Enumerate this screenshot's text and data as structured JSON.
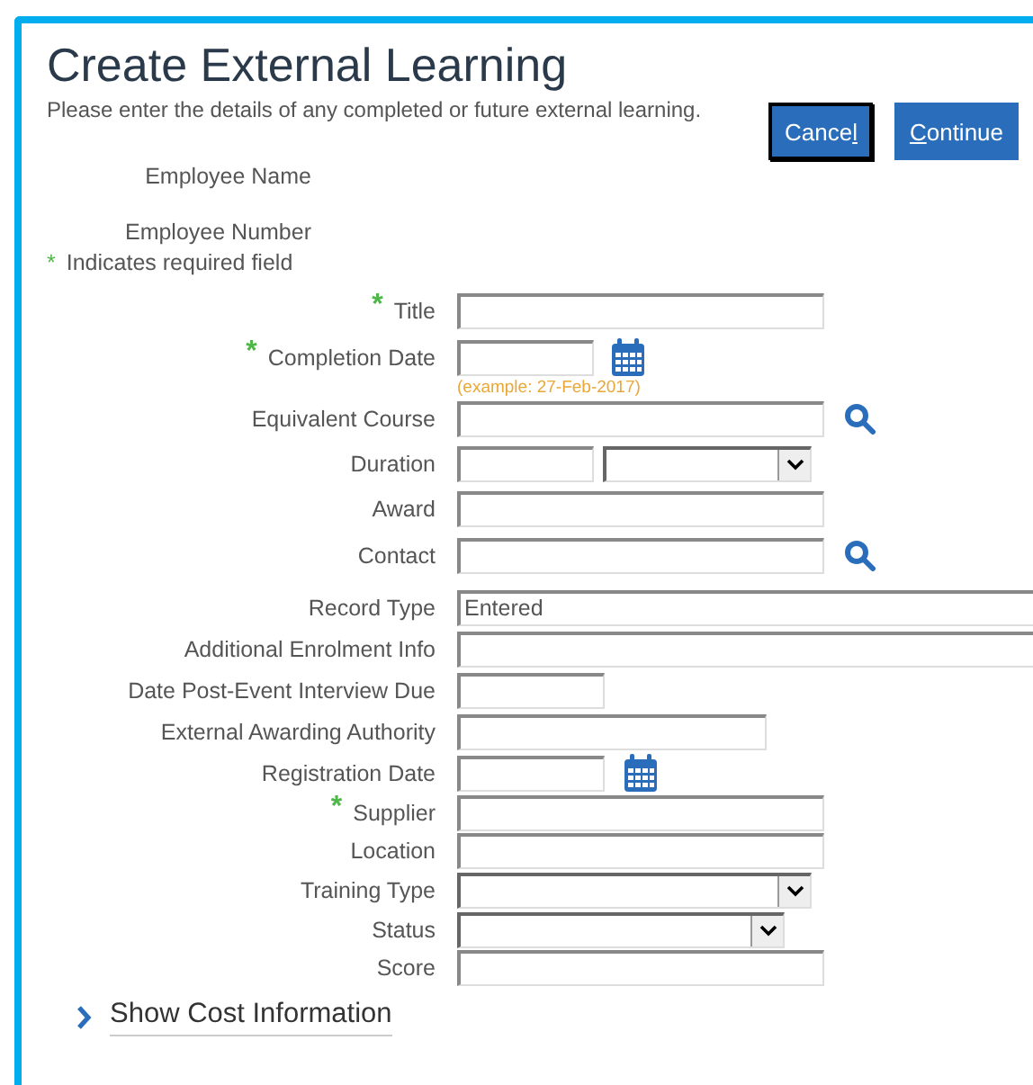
{
  "title": "Create External Learning",
  "intro": "Please enter the details of any completed or future external learning.",
  "buttons": [
    {
      "before": "Cance",
      "access_key": "l",
      "focused": true
    },
    {
      "access_key": "C",
      "after": "ontinue",
      "focused": false
    }
  ],
  "employee": [
    {
      "label": "Employee Name"
    },
    {
      "label": "Employee Number"
    }
  ],
  "required_note": {
    "mark": "*",
    "text": "Indicates required field"
  },
  "fields": [
    {
      "label": "Title",
      "required": true,
      "kind": "text"
    },
    {
      "label": "Completion Date",
      "required": true,
      "kind": "date",
      "hint": "(example: 27-Feb-2017)"
    },
    {
      "label": "Equivalent Course",
      "required": false,
      "kind": "lookup"
    },
    {
      "label": "Duration",
      "required": false,
      "kind": "duration"
    },
    {
      "label": "Award",
      "required": false,
      "kind": "text"
    },
    {
      "label": "Contact",
      "required": false,
      "kind": "lookup"
    },
    {
      "label": "Record Type",
      "required": false,
      "kind": "text",
      "value": "Entered"
    },
    {
      "label": "Additional Enrolment Info",
      "required": false,
      "kind": "text"
    },
    {
      "label": "Date Post-Event Interview Due",
      "required": false,
      "kind": "text"
    },
    {
      "label": "External Awarding Authority",
      "required": false,
      "kind": "text"
    },
    {
      "label": "Registration Date",
      "required": false,
      "kind": "date"
    },
    {
      "label": "Supplier",
      "required": true,
      "kind": "text"
    },
    {
      "label": "Location",
      "required": false,
      "kind": "text"
    },
    {
      "label": "Training Type",
      "required": false,
      "kind": "select"
    },
    {
      "label": "Status",
      "required": false,
      "kind": "select"
    },
    {
      "label": "Score",
      "required": false,
      "kind": "text"
    }
  ],
  "disclosure": {
    "label": "Show Cost Information",
    "expanded": false
  }
}
